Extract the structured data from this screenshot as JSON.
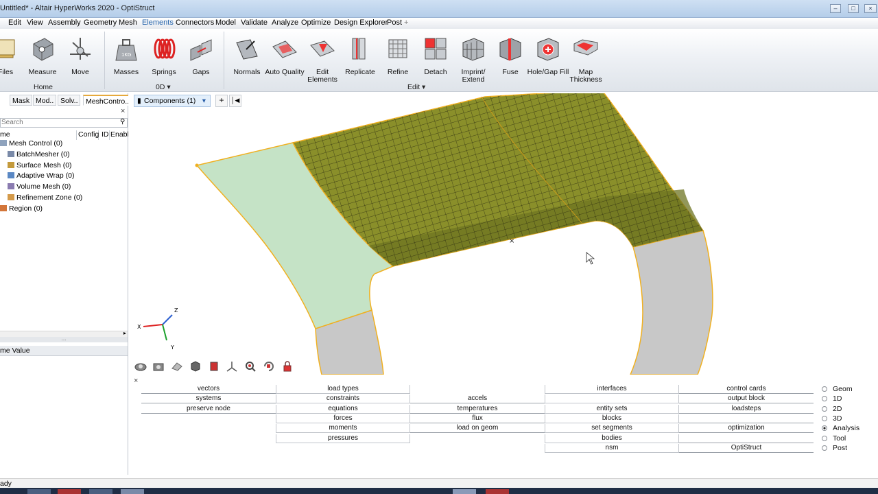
{
  "window": {
    "title": "Untitled* - Altair HyperWorks 2020 - OptiStruct"
  },
  "menu": [
    "Edit",
    "View",
    "Assembly",
    "Geometry",
    "Mesh",
    "Elements",
    "Connectors",
    "Model",
    "Validate",
    "Analyze",
    "Optimize",
    "Design Explorer",
    "Post",
    "+"
  ],
  "menu_active": "Elements",
  "ribbon": {
    "tools": [
      {
        "label": "Files",
        "icon": "files-icon"
      },
      {
        "label": "Measure",
        "icon": "measure-icon"
      },
      {
        "label": "Move",
        "icon": "move-icon"
      },
      {
        "label": "Masses",
        "icon": "masses-icon",
        "badge": "1KG"
      },
      {
        "label": "Springs",
        "icon": "springs-icon"
      },
      {
        "label": "Gaps",
        "icon": "gaps-icon"
      },
      {
        "label": "Normals",
        "icon": "normals-icon"
      },
      {
        "label": "Auto Quality",
        "icon": "auto-quality-icon"
      },
      {
        "label": "Edit Elements",
        "icon": "edit-elements-icon"
      },
      {
        "label": "Replicate",
        "icon": "replicate-icon"
      },
      {
        "label": "Refine",
        "icon": "refine-icon"
      },
      {
        "label": "Detach",
        "icon": "detach-icon"
      },
      {
        "label": "Imprint/ Extend",
        "icon": "imprint-extend-icon"
      },
      {
        "label": "Fuse",
        "icon": "fuse-icon"
      },
      {
        "label": "Hole/Gap Fill",
        "icon": "hole-gap-fill-icon"
      },
      {
        "label": "Map Thickness",
        "icon": "map-thickness-icon"
      }
    ],
    "groups": {
      "home": "Home",
      "zero_d": "0D",
      "edit": "Edit"
    }
  },
  "left_panel": {
    "tabs": [
      "Mask",
      "Mod..",
      "Solv..",
      "MeshContro.."
    ],
    "search_placeholder": "Search",
    "columns": [
      "me",
      "Config",
      "ID",
      "Enable"
    ],
    "tree": [
      {
        "label": "Mesh Control",
        "count": "(0)",
        "level": 0
      },
      {
        "label": "BatchMesher",
        "count": "(0)",
        "level": 1
      },
      {
        "label": "Surface Mesh",
        "count": "(0)",
        "level": 1
      },
      {
        "label": "Adaptive Wrap",
        "count": "(0)",
        "level": 1
      },
      {
        "label": "Volume Mesh",
        "count": "(0)",
        "level": 1
      },
      {
        "label": "Refinement Zone",
        "count": "(0)",
        "level": 1
      },
      {
        "label": "Region",
        "count": "(0)",
        "level": 0
      }
    ],
    "value_header": "me Value",
    "splitter_dots": "..."
  },
  "canvas": {
    "components_tab": "Components (1)",
    "axis": {
      "x": "X",
      "y": "Y",
      "z": "Z"
    },
    "colors": {
      "mesh_fill": "#8a8f2a",
      "mesh_fill_dark": "#6e7421",
      "mesh_line": "#2a2a10",
      "surface_green": "#c5e3c6",
      "surface_grey": "#c8c8c8",
      "edge": "#f0b020"
    }
  },
  "command_panel": {
    "col1": [
      "vectors",
      "systems",
      "preserve node"
    ],
    "col2": [
      "load types",
      "constraints",
      "equations",
      "forces",
      "moments",
      "pressures"
    ],
    "col3": [
      "accels",
      "temperatures",
      "flux",
      "load on geom"
    ],
    "col4": [
      "interfaces",
      "entity sets",
      "blocks",
      "set segments",
      "bodies",
      "nsm"
    ],
    "col5": [
      "control cards",
      "output block",
      "loadsteps",
      "optimization",
      "OptiStruct"
    ],
    "radios": [
      "Geom",
      "1D",
      "2D",
      "3D",
      "Analysis",
      "Tool",
      "Post"
    ],
    "radio_selected": "Analysis"
  },
  "status": {
    "text": "ady"
  }
}
